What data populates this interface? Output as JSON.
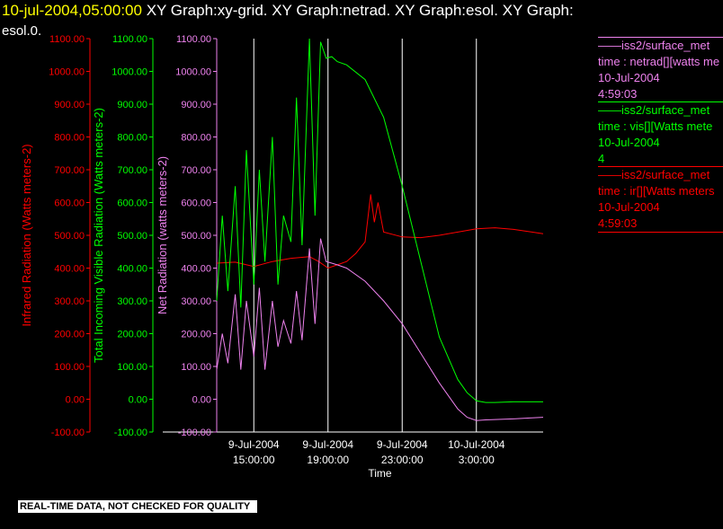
{
  "header": {
    "date": "10-jul-2004,05:00:00",
    "rest": "XY Graph:xy-grid.  XY Graph:netrad.  XY Graph:esol.  XY Graph:",
    "line2": "esol.0."
  },
  "legend": [
    {
      "source": "iss2/surface_met",
      "var": "time : netrad[][watts me",
      "date": "10-Jul-2004",
      "time": "4:59:03",
      "color": "#ee82ee"
    },
    {
      "source": "iss2/surface_met",
      "var": "time : vis[][Watts mete",
      "date": "10-Jul-2004",
      "time": "4",
      "color": "#00ff00"
    },
    {
      "source": "iss2/surface_met",
      "var": "time : ir[][Watts meters",
      "date": "10-Jul-2004",
      "time": "4:59:03",
      "color": "#ff0000"
    }
  ],
  "notice": "REAL-TIME DATA, NOT CHECKED FOR QUALITY",
  "chart_data": {
    "type": "line",
    "x_axis": {
      "label": "Time",
      "range_hours": [
        13.0,
        30.6
      ],
      "ticks": [
        {
          "hour": 15,
          "date": "9-Jul-2004",
          "time": "15:00:00"
        },
        {
          "hour": 19,
          "date": "9-Jul-2004",
          "time": "19:00:00"
        },
        {
          "hour": 23,
          "date": "9-Jul-2004",
          "time": "23:00:00"
        },
        {
          "hour": 27,
          "date": "10-Jul-2004",
          "time": "3:00:00"
        }
      ]
    },
    "y_axes": [
      {
        "id": "ir",
        "label": "Infrared Radiation (Watts meters-2)",
        "color": "#ff0000"
      },
      {
        "id": "vis",
        "label": "Total Incoming Visible Radiation (Watts meters-2)",
        "color": "#00ff00"
      },
      {
        "id": "net",
        "label": "Net Radiation (watts meters-2)",
        "color": "#ee82ee"
      }
    ],
    "ylim": [
      -100,
      1100
    ],
    "tick_labels": [
      "1100.00",
      "1000.00",
      "900.00",
      "800.00",
      "700.00",
      "600.00",
      "500.00",
      "400.00",
      "300.00",
      "200.00",
      "100.00",
      "0.00",
      "-100.00"
    ],
    "grid": "vertical lines at x ticks",
    "series": [
      {
        "axis": "ir",
        "color": "#ff0000",
        "x": [
          13.0,
          14.0,
          15.0,
          16.0,
          17.0,
          18.0,
          18.5,
          19.0,
          19.5,
          20.0,
          20.5,
          21.0,
          21.3,
          21.5,
          21.7,
          22.0,
          23.0,
          24.0,
          25.0,
          26.0,
          27.0,
          28.0,
          29.0,
          30.0,
          30.6
        ],
        "values": [
          415,
          418,
          405,
          420,
          430,
          435,
          420,
          400,
          410,
          420,
          445,
          480,
          625,
          540,
          600,
          510,
          495,
          493,
          500,
          510,
          520,
          523,
          518,
          510,
          505
        ]
      },
      {
        "axis": "vis",
        "color": "#00ff00",
        "x": [
          13.0,
          13.3,
          13.6,
          14.0,
          14.3,
          14.6,
          15.0,
          15.3,
          15.6,
          16.0,
          16.3,
          16.6,
          17.0,
          17.3,
          17.6,
          18.0,
          18.3,
          18.6,
          18.9,
          19.2,
          19.5,
          20.0,
          21.0,
          22.0,
          23.0,
          24.0,
          25.0,
          26.0,
          26.5,
          27.0,
          27.5,
          28.0,
          29.0,
          30.0,
          30.6
        ],
        "values": [
          300,
          560,
          330,
          650,
          280,
          760,
          350,
          700,
          420,
          800,
          350,
          560,
          480,
          920,
          470,
          1100,
          560,
          1090,
          1040,
          1045,
          1030,
          1020,
          975,
          860,
          650,
          420,
          190,
          60,
          20,
          -5,
          -10,
          -10,
          -8,
          -8,
          -8
        ]
      },
      {
        "axis": "net",
        "color": "#ee82ee",
        "x": [
          13.0,
          13.3,
          13.6,
          14.0,
          14.3,
          14.6,
          15.0,
          15.3,
          15.6,
          16.0,
          16.3,
          16.6,
          17.0,
          17.3,
          17.6,
          18.0,
          18.3,
          18.6,
          18.9,
          19.2,
          19.5,
          20.0,
          21.0,
          22.0,
          23.0,
          24.0,
          25.0,
          26.0,
          26.5,
          27.0,
          27.5,
          28.0,
          29.0,
          30.0,
          30.6
        ],
        "values": [
          90,
          200,
          110,
          320,
          90,
          300,
          130,
          340,
          90,
          300,
          160,
          240,
          170,
          330,
          180,
          460,
          230,
          490,
          420,
          415,
          410,
          400,
          360,
          300,
          230,
          140,
          50,
          -30,
          -55,
          -65,
          -63,
          -62,
          -60,
          -57,
          -55
        ]
      }
    ]
  }
}
